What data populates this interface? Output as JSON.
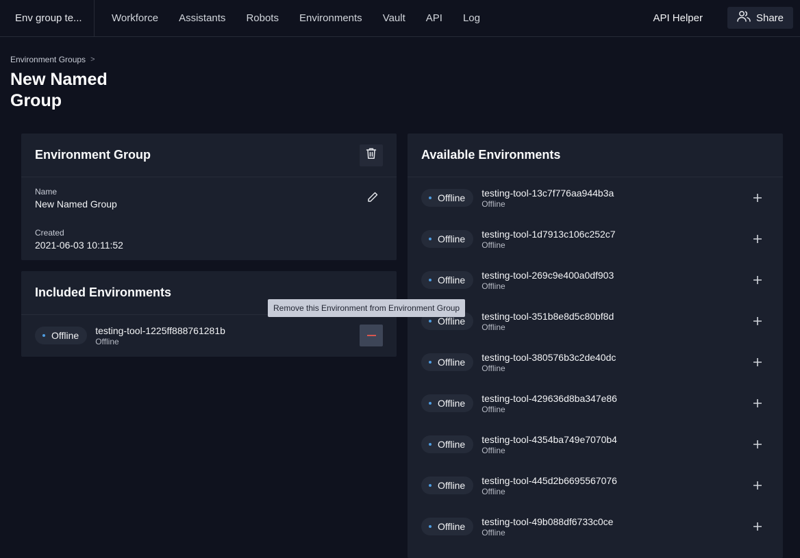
{
  "app": {
    "title": "Env group te..."
  },
  "nav": {
    "items": [
      {
        "label": "Workforce"
      },
      {
        "label": "Assistants"
      },
      {
        "label": "Robots"
      },
      {
        "label": "Environments"
      },
      {
        "label": "Vault"
      },
      {
        "label": "API"
      },
      {
        "label": "Log"
      }
    ],
    "api_helper": "API Helper",
    "share": {
      "label": "Share",
      "icon": "users-icon"
    }
  },
  "breadcrumb": {
    "parent": "Environment Groups",
    "separator": ">"
  },
  "page": {
    "title": "New Named Group"
  },
  "group_card": {
    "title": "Environment Group",
    "delete_icon": "trash-icon",
    "name_label": "Name",
    "name_value": "New Named Group",
    "edit_icon": "pencil-icon",
    "created_label": "Created",
    "created_value": "2021-06-03 10:11:52"
  },
  "included": {
    "title": "Included Environments",
    "items": [
      {
        "status": "Offline",
        "name": "testing-tool-1225ff888761281b",
        "substatus": "Offline"
      }
    ],
    "tooltip": "Remove this Environment from Environment Group"
  },
  "available": {
    "title": "Available Environments",
    "items": [
      {
        "status": "Offline",
        "name": "testing-tool-13c7f776aa944b3a",
        "substatus": "Offline"
      },
      {
        "status": "Offline",
        "name": "testing-tool-1d7913c106c252c7",
        "substatus": "Offline"
      },
      {
        "status": "Offline",
        "name": "testing-tool-269c9e400a0df903",
        "substatus": "Offline"
      },
      {
        "status": "Offline",
        "name": "testing-tool-351b8e8d5c80bf8d",
        "substatus": "Offline"
      },
      {
        "status": "Offline",
        "name": "testing-tool-380576b3c2de40dc",
        "substatus": "Offline"
      },
      {
        "status": "Offline",
        "name": "testing-tool-429636d8ba347e86",
        "substatus": "Offline"
      },
      {
        "status": "Offline",
        "name": "testing-tool-4354ba749e7070b4",
        "substatus": "Offline"
      },
      {
        "status": "Offline",
        "name": "testing-tool-445d2b6695567076",
        "substatus": "Offline"
      },
      {
        "status": "Offline",
        "name": "testing-tool-49b088df6733c0ce",
        "substatus": "Offline"
      }
    ]
  },
  "colors": {
    "background": "#0f121e",
    "card": "#1b202d",
    "status_dot": "#4e9ce0",
    "remove_accent": "#d9574f"
  }
}
